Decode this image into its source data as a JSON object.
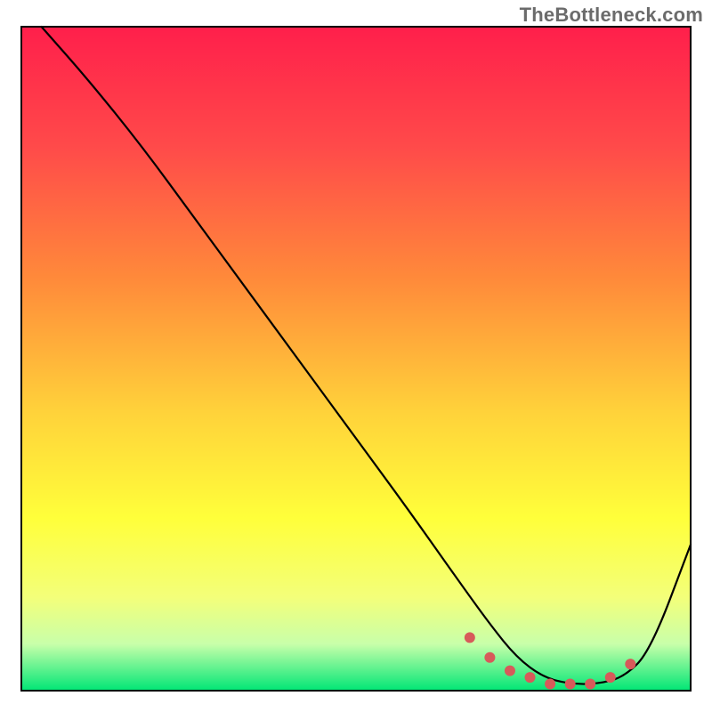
{
  "watermark": "TheBottleneck.com",
  "chart_data": {
    "type": "line",
    "title": "",
    "xlabel": "",
    "ylabel": "",
    "xlim": [
      0,
      100
    ],
    "ylim": [
      0,
      100
    ],
    "axes_visible": false,
    "grid": false,
    "gradient_stops": [
      {
        "offset": 0.0,
        "color": "#ff1f4b"
      },
      {
        "offset": 0.18,
        "color": "#ff4a4a"
      },
      {
        "offset": 0.38,
        "color": "#ff8a3a"
      },
      {
        "offset": 0.58,
        "color": "#ffd23a"
      },
      {
        "offset": 0.74,
        "color": "#ffff3a"
      },
      {
        "offset": 0.86,
        "color": "#f3ff7a"
      },
      {
        "offset": 0.93,
        "color": "#c8ffaa"
      },
      {
        "offset": 1.0,
        "color": "#00e676"
      }
    ],
    "series": [
      {
        "name": "bottleneck-curve",
        "stroke": "#000000",
        "stroke_width": 2.2,
        "x": [
          3,
          10,
          18,
          26,
          34,
          42,
          50,
          58,
          65,
          70,
          74,
          78,
          82,
          86,
          90,
          94,
          100
        ],
        "y": [
          100,
          92,
          82,
          71,
          60,
          49,
          38,
          27,
          17,
          10,
          5,
          2,
          1,
          1,
          2,
          6,
          22
        ]
      }
    ],
    "markers": {
      "name": "valley-highlight",
      "color": "#d75a5a",
      "radius": 6,
      "x": [
        67,
        70,
        73,
        76,
        79,
        82,
        85,
        88,
        91
      ],
      "y": [
        8,
        5,
        3,
        2,
        1,
        1,
        1,
        2,
        4
      ]
    }
  }
}
